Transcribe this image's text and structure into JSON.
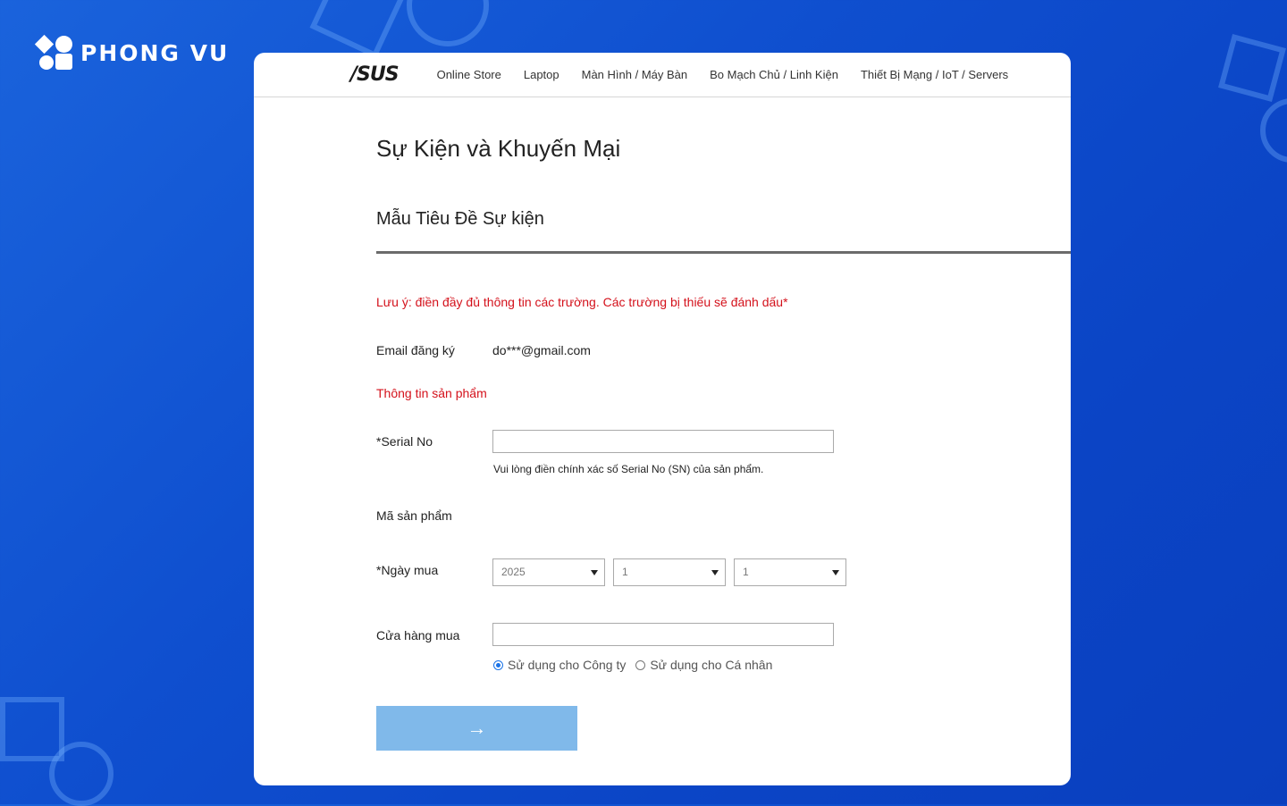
{
  "brand": {
    "name": "PHONG VU"
  },
  "nav": {
    "logo": "/SUS",
    "items": [
      "Online Store",
      "Laptop",
      "Màn Hình / Máy Bàn",
      "Bo Mạch Chủ / Linh Kiện",
      "Thiết Bị Mạng / IoT / Servers"
    ]
  },
  "page": {
    "title": "Sự Kiện và Khuyến Mại",
    "event_title": "Mẫu Tiêu Đề Sự kiện",
    "note": "Lưu ý: điền đầy đủ thông tin các trường. Các trường bị thiếu sẽ đánh dấu*"
  },
  "form": {
    "email_label": "Email đăng ký",
    "email_value": "do***@gmail.com",
    "product_section": "Thông tin sản phẩm",
    "serial_label": "*Serial No",
    "serial_value": "",
    "serial_hint": "Vui lòng điền chính xác số Serial No (SN) của sản phẩm.",
    "model_label": "Mã sản phẩm",
    "date_label": "*Ngày mua",
    "date_year": "2025",
    "date_month": "1",
    "date_day": "1",
    "store_label": "Cửa hàng mua",
    "store_value": "",
    "use_company": "Sử dụng cho Công ty",
    "use_personal": "Sử dụng cho Cá nhân",
    "selected_use": "company",
    "submit_icon": "→"
  },
  "colors": {
    "accent_red": "#d4111b",
    "button": "#80b9ea",
    "background": "#0f4fcf"
  },
  "icons": {
    "submit": "arrow-right-icon",
    "dropdown": "caret-down-icon"
  }
}
